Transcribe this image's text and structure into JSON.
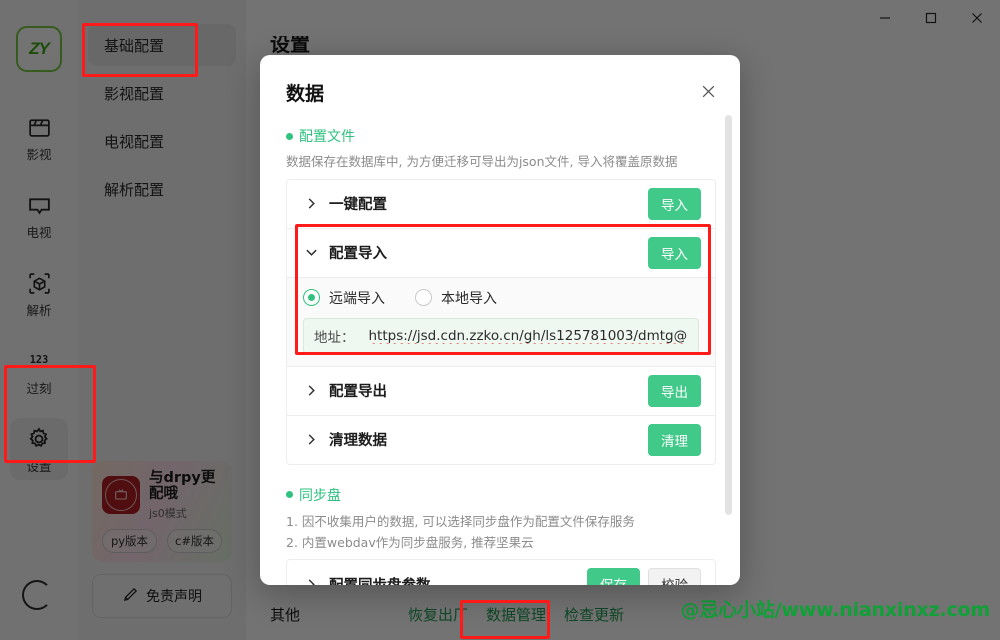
{
  "window": {
    "minimize_label": "minimize",
    "maximize_label": "maximize",
    "close_label": "close"
  },
  "rail": {
    "logo_text": "ZY",
    "items": [
      {
        "label": "影视",
        "icon": "film-icon",
        "active": false
      },
      {
        "label": "电视",
        "icon": "tv-icon",
        "active": false
      },
      {
        "label": "解析",
        "icon": "cube-icon",
        "active": false
      },
      {
        "label": "过刻",
        "icon": "numbers-123-icon",
        "active": false
      },
      {
        "label": "设置",
        "icon": "gear-icon",
        "active": true
      }
    ]
  },
  "subnav": {
    "items": [
      {
        "label": "基础配置",
        "active": true
      },
      {
        "label": "影视配置",
        "active": false
      },
      {
        "label": "电视配置",
        "active": false
      },
      {
        "label": "解析配置",
        "active": false
      }
    ],
    "promo": {
      "title": "与drpy更配哦",
      "subtitle": "js0模式",
      "tags": [
        "py版本",
        "c#版本"
      ]
    },
    "disclaimer_label": "免责声明"
  },
  "content": {
    "title": "设置",
    "footer": {
      "label": "其他",
      "links": [
        "恢复出厂",
        "数据管理",
        "检查更新"
      ]
    }
  },
  "watermark": "@忌心小站/www.nianxinxz.com",
  "modal": {
    "title": "数据",
    "close_label": "×",
    "sections": [
      {
        "title": "配置文件",
        "desc": "数据保存在数据库中, 为方便迁移可导出为json文件, 导入将覆盖原数据"
      },
      {
        "title": "同步盘",
        "lines": [
          "1. 因不收集用户的数据, 可以选择同步盘作为配置文件保存服务",
          "2. 内置webdav作为同步盘服务, 推荐坚果云"
        ]
      }
    ],
    "rows": {
      "one_key": {
        "label": "一键配置",
        "button": "导入",
        "chevron": "chevron-right"
      },
      "import": {
        "label": "配置导入",
        "button": "导入",
        "chevron": "chevron-down"
      },
      "export": {
        "label": "配置导出",
        "button": "导出",
        "chevron": "chevron-right"
      },
      "clear": {
        "label": "清理数据",
        "button": "清理",
        "chevron": "chevron-right"
      },
      "sync_params": {
        "label": "配置同步盘参数",
        "button_save": "保存",
        "button_verify": "校验",
        "chevron": "chevron-right"
      }
    },
    "import_options": {
      "remote": {
        "label": "远端导入",
        "selected": true
      },
      "local": {
        "label": "本地导入",
        "selected": false
      },
      "address_label": "地址：",
      "address_value": "https://jsd.cdn.zzko.cn/gh/ls125781003/dmtg@"
    }
  },
  "colors": {
    "accent_green": "#2ec27e",
    "button_green": "#41c98a",
    "annotation_red": "#ff1a1a",
    "link_green": "#1f9d55",
    "watermark_green": "#10a037"
  }
}
